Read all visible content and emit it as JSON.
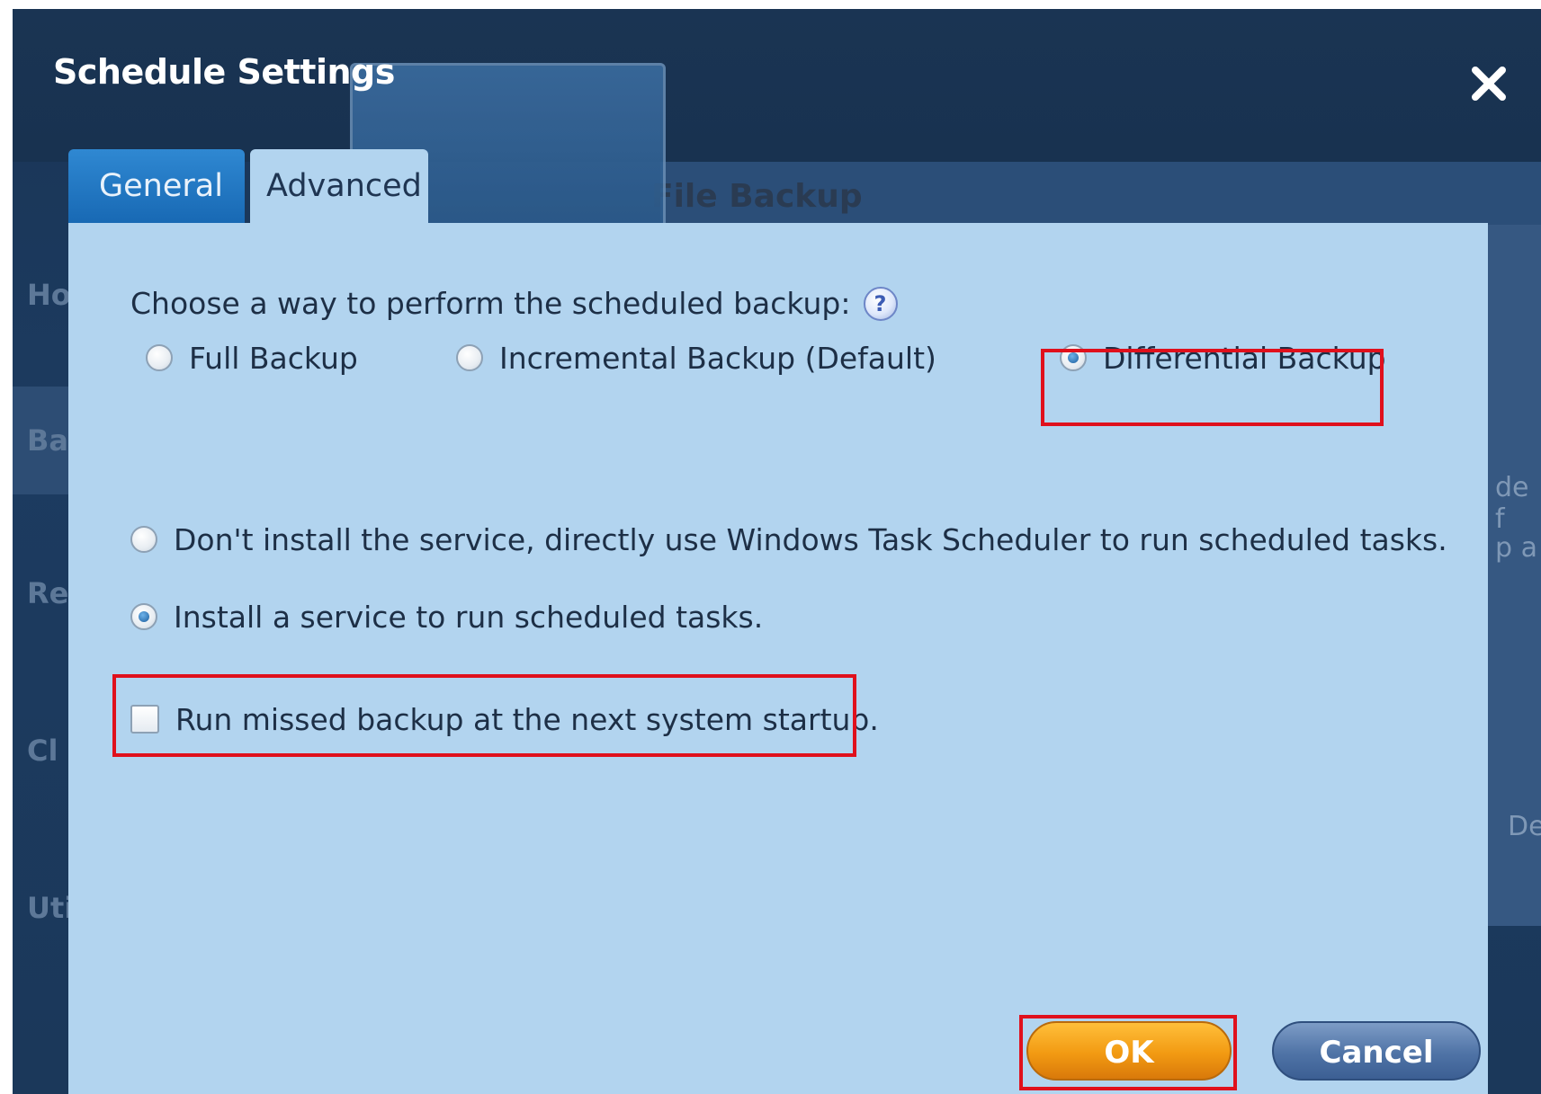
{
  "dialog": {
    "title": "Schedule Settings",
    "close_glyph": "X"
  },
  "tabs": [
    {
      "label": "General",
      "active": false
    },
    {
      "label": "Advanced",
      "active": true
    }
  ],
  "backup_method": {
    "question": "Choose a way to perform the scheduled backup:",
    "help_glyph": "?",
    "options": [
      {
        "label": "Full Backup",
        "checked": false
      },
      {
        "label": "Incremental Backup (Default)",
        "checked": false
      },
      {
        "label": "Differential Backup",
        "checked": true
      }
    ]
  },
  "scheduler": {
    "options": [
      {
        "label": "Don't install the service, directly use Windows Task Scheduler to run scheduled tasks.",
        "checked": false
      },
      {
        "label": "Install a service to run scheduled tasks.",
        "checked": true
      }
    ]
  },
  "missed_backup": {
    "label": "Run missed backup at the next system startup.",
    "checked": false
  },
  "buttons": {
    "ok_label": "OK",
    "cancel_label": "Cancel"
  },
  "background": {
    "behind_text": "File Backup",
    "left_items": [
      "Ho",
      "Ba",
      "Re",
      "Cl",
      "Uti"
    ],
    "right_fragments": [
      "de f",
      "p a",
      "De"
    ]
  },
  "colors": {
    "panel": "#b2d4ef",
    "tab_inactive": "#1f7bc8",
    "highlight": "#e0101c",
    "ok_button": "#f29a12",
    "cancel_button": "#4f73a6"
  }
}
